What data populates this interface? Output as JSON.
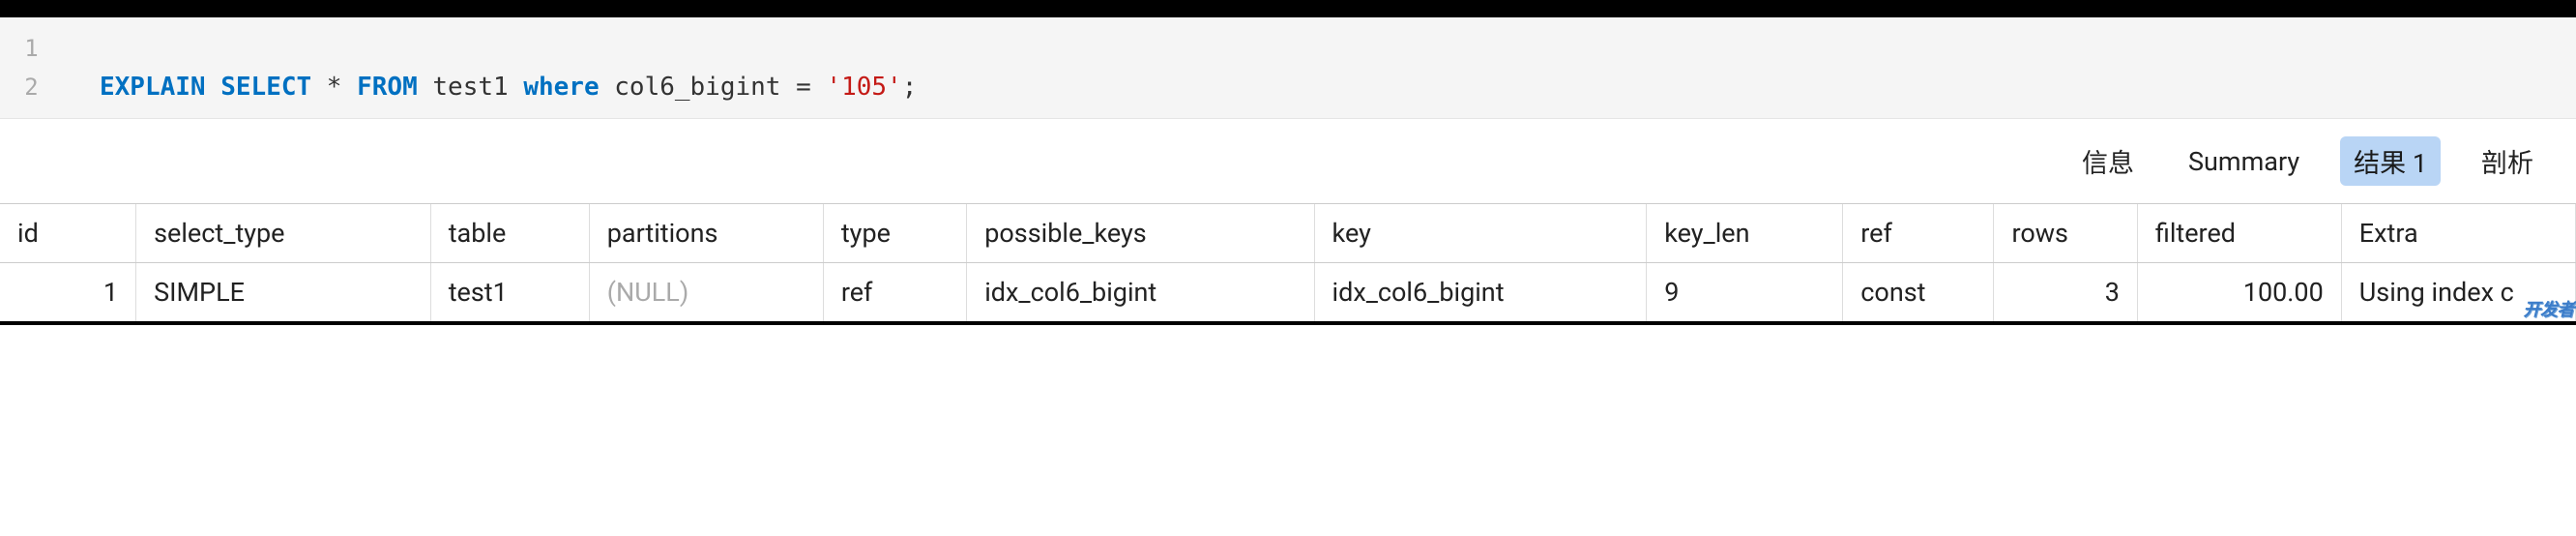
{
  "editor": {
    "lines": [
      {
        "num": "1",
        "tokens": []
      },
      {
        "num": "2",
        "tokens": [
          {
            "t": "EXPLAIN",
            "c": "kw-blue"
          },
          {
            "t": " "
          },
          {
            "t": "SELECT",
            "c": "kw-blue"
          },
          {
            "t": " * "
          },
          {
            "t": "FROM",
            "c": "kw-blue"
          },
          {
            "t": " test1 ",
            "c": "ident"
          },
          {
            "t": "where",
            "c": "kw-blue"
          },
          {
            "t": " col6_bigint = ",
            "c": "ident"
          },
          {
            "t": "'105'",
            "c": "str-red"
          },
          {
            "t": ";"
          }
        ]
      }
    ]
  },
  "tabs": {
    "items": [
      {
        "label": "信息",
        "active": false
      },
      {
        "label": "Summary",
        "active": false
      },
      {
        "label": "结果 1",
        "active": true
      },
      {
        "label": "剖析",
        "active": false
      }
    ]
  },
  "result_table": {
    "columns": [
      "id",
      "select_type",
      "table",
      "partitions",
      "type",
      "possible_keys",
      "key",
      "key_len",
      "ref",
      "rows",
      "filtered",
      "Extra"
    ],
    "rows": [
      {
        "id": "1",
        "select_type": "SIMPLE",
        "table": "test1",
        "partitions": "(NULL)",
        "type": "ref",
        "possible_keys": "idx_col6_bigint",
        "key": "idx_col6_bigint",
        "key_len": "9",
        "ref": "const",
        "rows": "3",
        "filtered": "100.00",
        "Extra": "Using index c"
      }
    ]
  },
  "watermark": "开发者"
}
